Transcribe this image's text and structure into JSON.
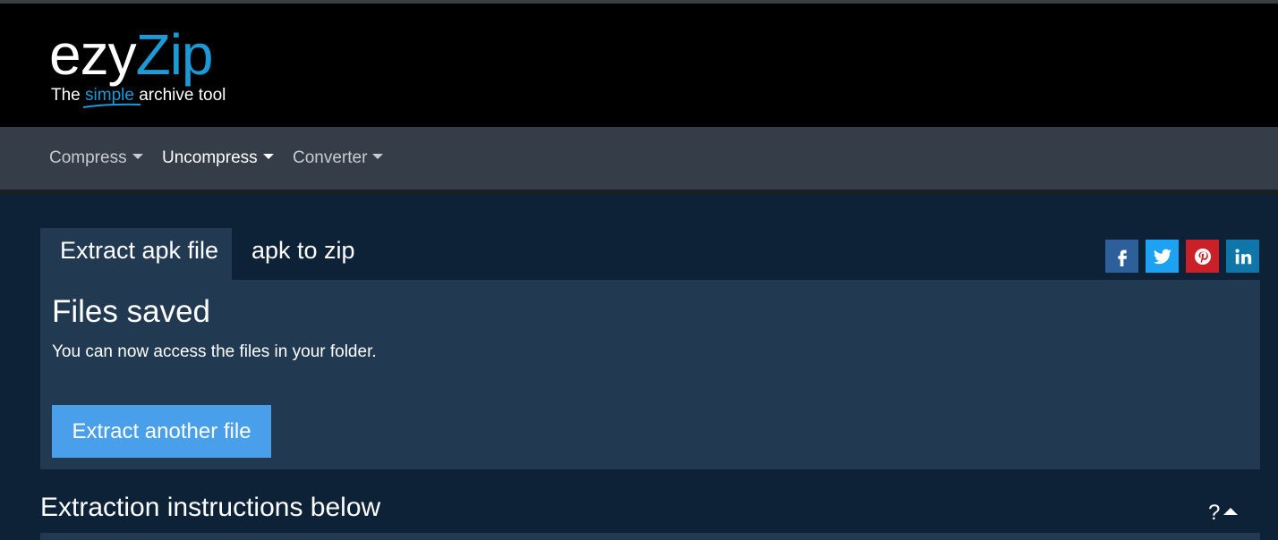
{
  "brand": {
    "logo_ezy": "ezy",
    "logo_zip": "Zip",
    "tagline_pre": "The ",
    "tagline_simple": "simple",
    "tagline_post": " archive tool",
    "colors": {
      "accent": "#1c9ad6",
      "header_bg": "#000000",
      "nav_bg": "#343d48",
      "page_bg": "#0e2237",
      "panel_bg": "#213a52",
      "button": "#4a9fea"
    }
  },
  "nav": {
    "items": [
      {
        "label": "Compress"
      },
      {
        "label": "Uncompress"
      },
      {
        "label": "Converter"
      }
    ],
    "active": "Uncompress"
  },
  "tabs": [
    {
      "label": "Extract apk file"
    },
    {
      "label": "apk to zip"
    }
  ],
  "share": [
    {
      "icon": "facebook-icon",
      "glyph": "f"
    },
    {
      "icon": "twitter-icon",
      "glyph": "t"
    },
    {
      "icon": "pinterest-icon",
      "glyph": "p"
    },
    {
      "icon": "linkedin-icon",
      "glyph": "in"
    }
  ],
  "panel": {
    "title": "Files saved",
    "text": "You can now access the files in your folder.",
    "button_label": "Extract another file"
  },
  "instructions": {
    "heading": "Extraction instructions below",
    "help": "?"
  }
}
